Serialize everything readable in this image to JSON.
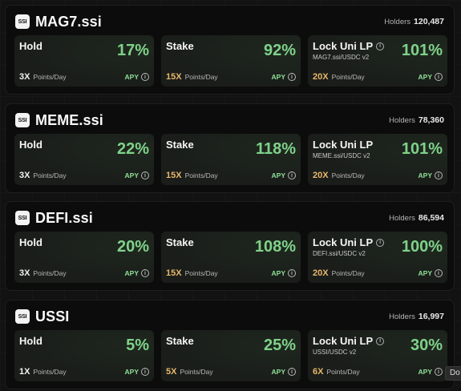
{
  "labels": {
    "holders": "Holders",
    "points_per_day": "Points/Day",
    "apy": "APY",
    "hold": "Hold",
    "stake": "Stake",
    "lock": "Lock Uni LP",
    "logo_text": "SSI"
  },
  "panels": [
    {
      "title": "MAG7.ssi",
      "holders": "120,487",
      "hold": {
        "value": "17%",
        "multiplier": "3X"
      },
      "stake": {
        "value": "92%",
        "multiplier": "15X"
      },
      "lock": {
        "value": "101%",
        "multiplier": "20X",
        "pair": "MAG7.ssi/USDC v2"
      }
    },
    {
      "title": "MEME.ssi",
      "holders": "78,360",
      "hold": {
        "value": "22%",
        "multiplier": "3X"
      },
      "stake": {
        "value": "118%",
        "multiplier": "15X"
      },
      "lock": {
        "value": "101%",
        "multiplier": "20X",
        "pair": "MEME.ssi/USDC v2"
      }
    },
    {
      "title": "DEFI.ssi",
      "holders": "86,594",
      "hold": {
        "value": "20%",
        "multiplier": "3X"
      },
      "stake": {
        "value": "108%",
        "multiplier": "15X"
      },
      "lock": {
        "value": "100%",
        "multiplier": "20X",
        "pair": "DEFI.ssi/USDC v2"
      }
    },
    {
      "title": "USSI",
      "holders": "16,997",
      "hold": {
        "value": "5%",
        "multiplier": "1X"
      },
      "stake": {
        "value": "25%",
        "multiplier": "5X"
      },
      "lock": {
        "value": "30%",
        "multiplier": "6X",
        "pair": "USSI/USDC v2"
      }
    }
  ],
  "tooltip": "Do",
  "colors": {
    "apy_value": "#7fd28a",
    "multiplier_gold": "#e8b86a",
    "card_bg": "#1a1d1a"
  },
  "icons": [
    "ssi-logo-icon",
    "info-icon"
  ]
}
